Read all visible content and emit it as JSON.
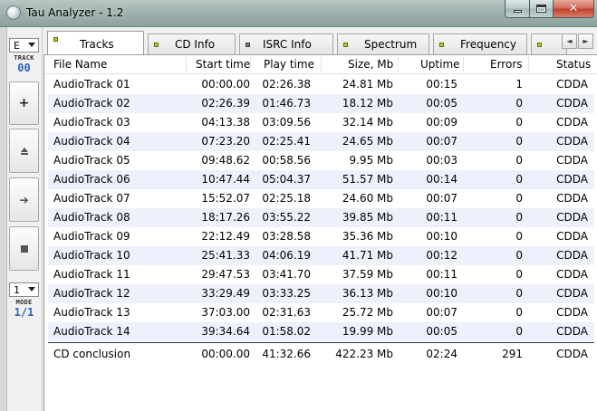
{
  "window": {
    "title": "Tau Analyzer - 1.2",
    "minimize_glyph": "",
    "close_glyph": "✕"
  },
  "toolbar": {
    "drive_select": "E",
    "track_label": "TRACK",
    "track_value": "00",
    "add_glyph": "+",
    "forward_glyph": "➔",
    "mode_select": "1",
    "mode_label": "MODE",
    "mode_value": "1/1"
  },
  "tabs": [
    {
      "label": "Tracks",
      "led": "green",
      "active": true
    },
    {
      "label": "CD Info",
      "led": "green",
      "active": false
    },
    {
      "label": "ISRC Info",
      "led": "gray",
      "active": false
    },
    {
      "label": "Spectrum",
      "led": "green",
      "active": false
    },
    {
      "label": "Frequency",
      "led": "green",
      "active": false
    }
  ],
  "tab_scroll": {
    "left": "◄",
    "right": "►"
  },
  "table": {
    "columns": [
      "File Name",
      "Start time",
      "Play time",
      "Size, Mb",
      "Uptime",
      "Errors",
      "Status"
    ],
    "rows": [
      [
        "AudioTrack 01",
        "00:00.00",
        "02:26.38",
        "24.81 Mb",
        "00:15",
        "1",
        "CDDA"
      ],
      [
        "AudioTrack 02",
        "02:26.39",
        "01:46.73",
        "18.12 Mb",
        "00:05",
        "0",
        "CDDA"
      ],
      [
        "AudioTrack 03",
        "04:13.38",
        "03:09.56",
        "32.14 Mb",
        "00:09",
        "0",
        "CDDA"
      ],
      [
        "AudioTrack 04",
        "07:23.20",
        "02:25.41",
        "24.65 Mb",
        "00:07",
        "0",
        "CDDA"
      ],
      [
        "AudioTrack 05",
        "09:48.62",
        "00:58.56",
        "9.95 Mb",
        "00:03",
        "0",
        "CDDA"
      ],
      [
        "AudioTrack 06",
        "10:47.44",
        "05:04.37",
        "51.57 Mb",
        "00:14",
        "0",
        "CDDA"
      ],
      [
        "AudioTrack 07",
        "15:52.07",
        "02:25.18",
        "24.60 Mb",
        "00:07",
        "0",
        "CDDA"
      ],
      [
        "AudioTrack 08",
        "18:17.26",
        "03:55.22",
        "39.85 Mb",
        "00:11",
        "0",
        "CDDA"
      ],
      [
        "AudioTrack 09",
        "22:12.49",
        "03:28.58",
        "35.36 Mb",
        "00:10",
        "0",
        "CDDA"
      ],
      [
        "AudioTrack 10",
        "25:41.33",
        "04:06.19",
        "41.71 Mb",
        "00:12",
        "0",
        "CDDA"
      ],
      [
        "AudioTrack 11",
        "29:47.53",
        "03:41.70",
        "37.59 Mb",
        "00:11",
        "0",
        "CDDA"
      ],
      [
        "AudioTrack 12",
        "33:29.49",
        "03:33.25",
        "36.13 Mb",
        "00:10",
        "0",
        "CDDA"
      ],
      [
        "AudioTrack 13",
        "37:03.00",
        "02:31.63",
        "25.72 Mb",
        "00:07",
        "0",
        "CDDA"
      ],
      [
        "AudioTrack 14",
        "39:34.64",
        "01:58.02",
        "19.99 Mb",
        "00:05",
        "0",
        "CDDA"
      ]
    ],
    "summary": [
      "CD conclusion",
      "00:00.00",
      "41:32.66",
      "422.23 Mb",
      "02:24",
      "291",
      "CDDA"
    ]
  }
}
